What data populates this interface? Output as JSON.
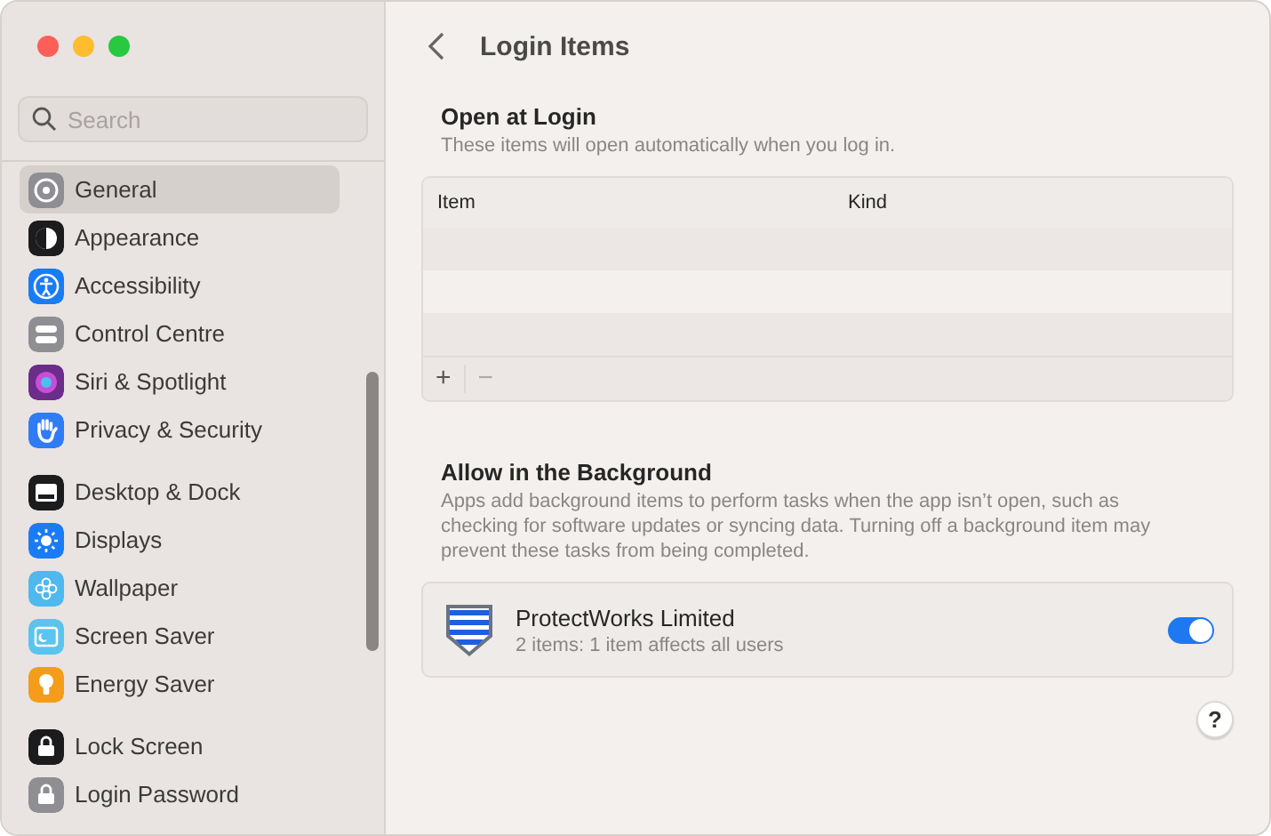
{
  "window": {
    "title": "Login Items"
  },
  "sidebar": {
    "search": {
      "placeholder": "Search"
    },
    "groups": [
      [
        {
          "label": "General",
          "selected": true,
          "color": "#8e8e93"
        },
        {
          "label": "Appearance",
          "selected": false,
          "color": "#1c1c1e"
        },
        {
          "label": "Accessibility",
          "selected": false,
          "color": "#1a7cf5"
        },
        {
          "label": "Control Centre",
          "selected": false,
          "color": "#8e8e93"
        },
        {
          "label": "Siri & Spotlight",
          "selected": false,
          "color": "#6b2c8a"
        },
        {
          "label": "Privacy & Security",
          "selected": false,
          "color": "#2f7cf6"
        }
      ],
      [
        {
          "label": "Desktop & Dock",
          "selected": false,
          "color": "#1c1c1e"
        },
        {
          "label": "Displays",
          "selected": false,
          "color": "#1a7cf5"
        },
        {
          "label": "Wallpaper",
          "selected": false,
          "color": "#4fb8ee"
        },
        {
          "label": "Screen Saver",
          "selected": false,
          "color": "#5ac4ef"
        },
        {
          "label": "Energy Saver",
          "selected": false,
          "color": "#f59c1a"
        }
      ],
      [
        {
          "label": "Lock Screen",
          "selected": false,
          "color": "#1c1c1e"
        },
        {
          "label": "Login Password",
          "selected": false,
          "color": "#8e8e93"
        }
      ]
    ]
  },
  "open_at_login": {
    "title": "Open at Login",
    "description": "These items will open automatically when you log in.",
    "table": {
      "columns": [
        "Item",
        "Kind"
      ]
    },
    "buttons": [
      "+",
      "−"
    ]
  },
  "allow_in_background": {
    "title": "Allow in the Background",
    "description": "Apps add background items to perform tasks when the app isn’t open, such as checking for software updates or syncing data. Turning off a background item may prevent these tasks from being completed.",
    "items": [
      {
        "name": "ProtectWorks Limited",
        "detail": "2 items: 1 item affects all users",
        "on": true
      }
    ]
  },
  "help": {
    "label": "?"
  }
}
